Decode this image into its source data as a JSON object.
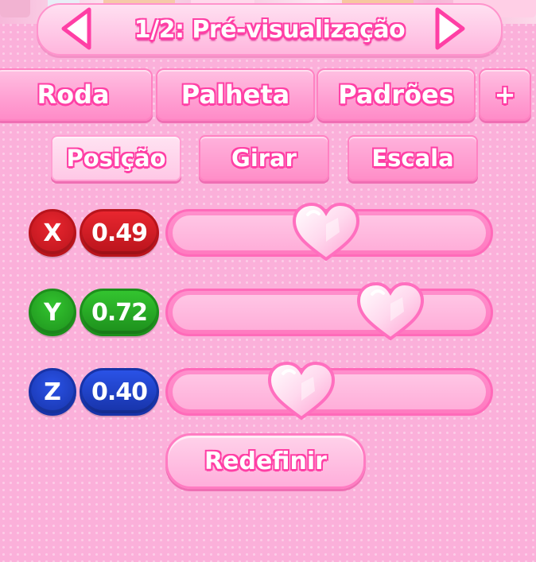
{
  "header": {
    "title": "1/2: Pré-visualização",
    "prev_icon": "arrow-left-icon",
    "next_icon": "arrow-right-icon"
  },
  "tabs": [
    {
      "label": "Roda"
    },
    {
      "label": "Palheta"
    },
    {
      "label": "Padrões"
    },
    {
      "label": "+"
    }
  ],
  "subtabs": [
    {
      "label": "Posição",
      "active": true
    },
    {
      "label": "Girar",
      "active": false
    },
    {
      "label": "Escala",
      "active": false
    }
  ],
  "sliders": [
    {
      "axis": "X",
      "value": "0.49",
      "level": 0.49,
      "color": "#e8262f",
      "dark": "#b9141c"
    },
    {
      "axis": "Y",
      "value": "0.72",
      "level": 0.72,
      "color": "#33c42f",
      "dark": "#1d8f1c"
    },
    {
      "axis": "Z",
      "value": "0.40",
      "level": 0.4,
      "color": "#2a52e6",
      "dark": "#1733a8"
    }
  ],
  "reset_label": "Redefinir",
  "colors": {
    "accent": "#ff3fa5",
    "panel": "#fbb0da"
  }
}
